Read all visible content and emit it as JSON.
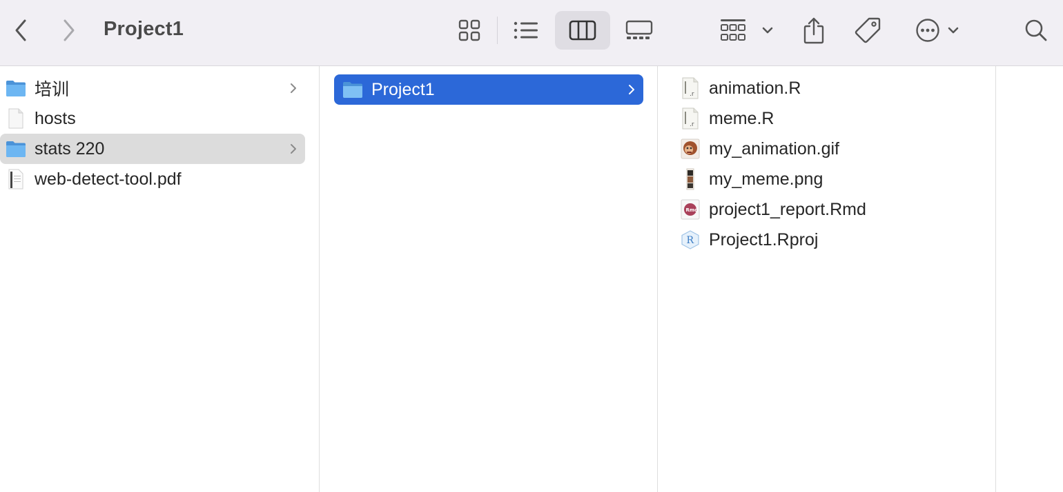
{
  "window": {
    "title": "Project1"
  },
  "toolbar": {
    "back_icon": "chevron-left-icon",
    "forward_icon": "chevron-right-icon",
    "view_icons": [
      "grid-view-icon",
      "list-view-icon",
      "column-view-icon",
      "gallery-view-icon"
    ],
    "active_view": "column-view-icon",
    "group_icon": "group-by-icon",
    "share_icon": "share-icon",
    "tag_icon": "tag-icon",
    "more_icon": "ellipsis-circle-icon",
    "search_icon": "search-icon"
  },
  "column1": {
    "items": [
      {
        "label": "培训",
        "icon": "folder-icon",
        "has_children": true
      },
      {
        "label": "hosts",
        "icon": "file-icon",
        "has_children": false
      },
      {
        "label": "stats 220",
        "icon": "folder-icon",
        "has_children": true,
        "selected": true
      },
      {
        "label": "web-detect-tool.pdf",
        "icon": "pdf-file-icon",
        "has_children": false
      }
    ]
  },
  "column2": {
    "items": [
      {
        "label": "Project1",
        "icon": "folder-icon",
        "has_children": true,
        "selected": true
      }
    ]
  },
  "column3": {
    "items": [
      {
        "label": "animation.R",
        "icon": "r-script-icon"
      },
      {
        "label": "meme.R",
        "icon": "r-script-icon"
      },
      {
        "label": "my_animation.gif",
        "icon": "gif-image-icon"
      },
      {
        "label": "my_meme.png",
        "icon": "png-image-icon"
      },
      {
        "label": "project1_report.Rmd",
        "icon": "rmd-file-icon"
      },
      {
        "label": "Project1.Rproj",
        "icon": "rproj-file-icon"
      }
    ]
  },
  "colors": {
    "selection_active": "#2c68d8",
    "selection_inactive": "#dcdcdc",
    "folder": "#5fa8ea",
    "toolbar_bg": "#f1eff4"
  }
}
